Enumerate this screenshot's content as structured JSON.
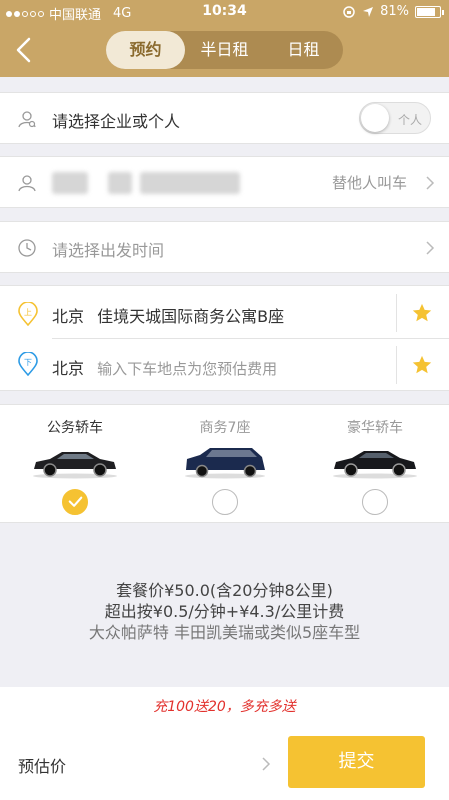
{
  "status_bar": {
    "carrier": "中国联通",
    "network": "4G",
    "time": "10:34",
    "battery": "81%",
    "battery_level": 0.81
  },
  "header": {
    "tabs": [
      {
        "label": "预约",
        "active": true
      },
      {
        "label": "半日租",
        "active": false
      },
      {
        "label": "日租",
        "active": false
      }
    ]
  },
  "account_row": {
    "label": "请选择企业或个人",
    "toggle_label": "个人",
    "toggle_on": false
  },
  "passenger_row": {
    "action": "替他人叫车"
  },
  "time_row": {
    "placeholder": "请选择出发时间"
  },
  "pickup": {
    "city": "北京",
    "address": "佳境天城国际商务公寓B座",
    "icon_label": "上"
  },
  "dropoff": {
    "city": "北京",
    "placeholder": "输入下车地点为您预估费用",
    "icon_label": "下"
  },
  "car_types": [
    {
      "name": "公务轿车",
      "selected": true
    },
    {
      "name": "商务7座",
      "selected": false
    },
    {
      "name": "豪华轿车",
      "selected": false
    }
  ],
  "pricing": {
    "line1": "套餐价¥50.0(含20分钟8公里)",
    "line2": "超出按¥0.5/分钟+¥4.3/公里计费",
    "line3": "大众帕萨特 丰田凯美瑞或类似5座车型"
  },
  "promo": {
    "text": "充100送20，多充多送"
  },
  "footer": {
    "estimate_label": "预估价",
    "submit_label": "提交"
  },
  "colors": {
    "header": "#c9a667",
    "accent": "#f5c232",
    "promo": "#e2312d"
  }
}
